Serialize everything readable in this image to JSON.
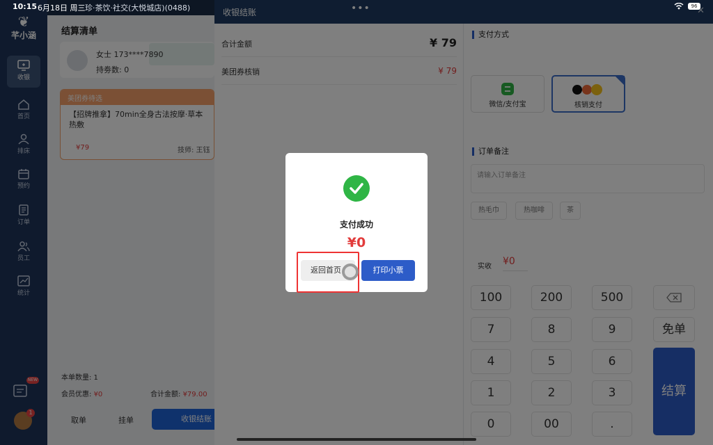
{
  "status_bar": {
    "time": "10:15",
    "date": "6月18日 周三",
    "store": "珍·茶饮·社交(大悦城店)(0488)",
    "battery": "96"
  },
  "sidebar": {
    "logo": "芊小涵",
    "items": [
      {
        "label": "收银",
        "icon": "monitor-icon"
      },
      {
        "label": "首页",
        "icon": "home-icon"
      },
      {
        "label": "排床",
        "icon": "user-icon"
      },
      {
        "label": "预约",
        "icon": "calendar-icon"
      },
      {
        "label": "订单",
        "icon": "list-icon"
      },
      {
        "label": "员工",
        "icon": "staff-icon"
      },
      {
        "label": "统计",
        "icon": "chart-icon"
      }
    ],
    "badge": "NEW",
    "avatar_badge": "1"
  },
  "checkout_list": {
    "title": "结算清单",
    "member_name": "女士 173****7890",
    "points": "持劵数: 0",
    "coupon_header": "美团券待选",
    "coupon_item": "【招牌推拿】70min全身古法按摩·草本热敷",
    "coupon_price": "¥79",
    "technician": "技师: 王钰",
    "count": "本单数量: 1",
    "member_discount_label": "会员优惠:",
    "member_discount": "¥0",
    "total_label": "合计金额:",
    "total": "¥79.00",
    "btn_takeout": "取单",
    "btn_hold": "挂单",
    "btn_checkout": "收银结账"
  },
  "panel": {
    "title": "收银结账",
    "rows": [
      {
        "label": "合计金额",
        "value": "¥ 79"
      },
      {
        "label": "美团券核销",
        "value": "¥ 79"
      }
    ],
    "payment_title": "支付方式",
    "payment_options": [
      {
        "label": "微信/支付宝",
        "icon": "wechat-alipay-icon"
      },
      {
        "label": "核销支付",
        "icon": "douyin-meituan-icon",
        "selected": true
      }
    ],
    "note_title": "订单备注",
    "note_placeholder": "请输入订单备注",
    "tags": [
      "热毛巾",
      "热咖啡",
      "茶"
    ],
    "paid_label": "实收",
    "paid_value": "¥0",
    "keypad": [
      [
        "100",
        "200",
        "500"
      ],
      [
        "7",
        "8",
        "9"
      ],
      [
        "4",
        "5",
        "6"
      ],
      [
        "1",
        "2",
        "3"
      ],
      [
        "0",
        "00",
        "."
      ]
    ],
    "key_free": "免单",
    "key_settle": "结算",
    "dots": "•••"
  },
  "modal": {
    "message": "支付成功",
    "amount": "¥0",
    "btn_home": "返回首页",
    "btn_print": "打印小票"
  },
  "colors": {
    "brand_navy": "#1f3b62",
    "accent_blue": "#2d5cc8",
    "success_green": "#2fb545",
    "price_red": "#e23b3b"
  }
}
